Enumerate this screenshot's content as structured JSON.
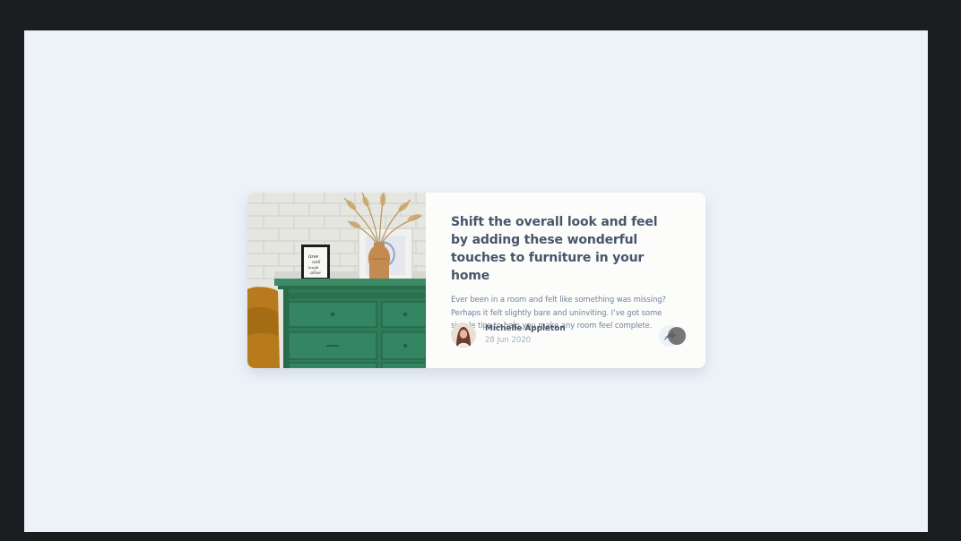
{
  "article": {
    "title": "Shift the overall look and feel by adding these wonderful touches to furniture in your home",
    "description": "Ever been in a room and felt like something was missing? Perhaps it felt slightly bare and uninviting. I’ve got some simple tips to help you make any room feel complete.",
    "image_icon": "drawers-photo",
    "frame_text": "love well laugh alive"
  },
  "author": {
    "name": "Michelle Appleton",
    "date": "28 Jun 2020",
    "avatar_icon": "avatar-photo"
  },
  "share": {
    "icon": "share-icon"
  },
  "colors": {
    "background": "#ecf2f8",
    "card": "#fcfdfb",
    "title": "#48556a",
    "text": "#6e8098",
    "muted": "#9eafc2",
    "dresser": "#2f7a57",
    "frame": "#1c1d21"
  }
}
